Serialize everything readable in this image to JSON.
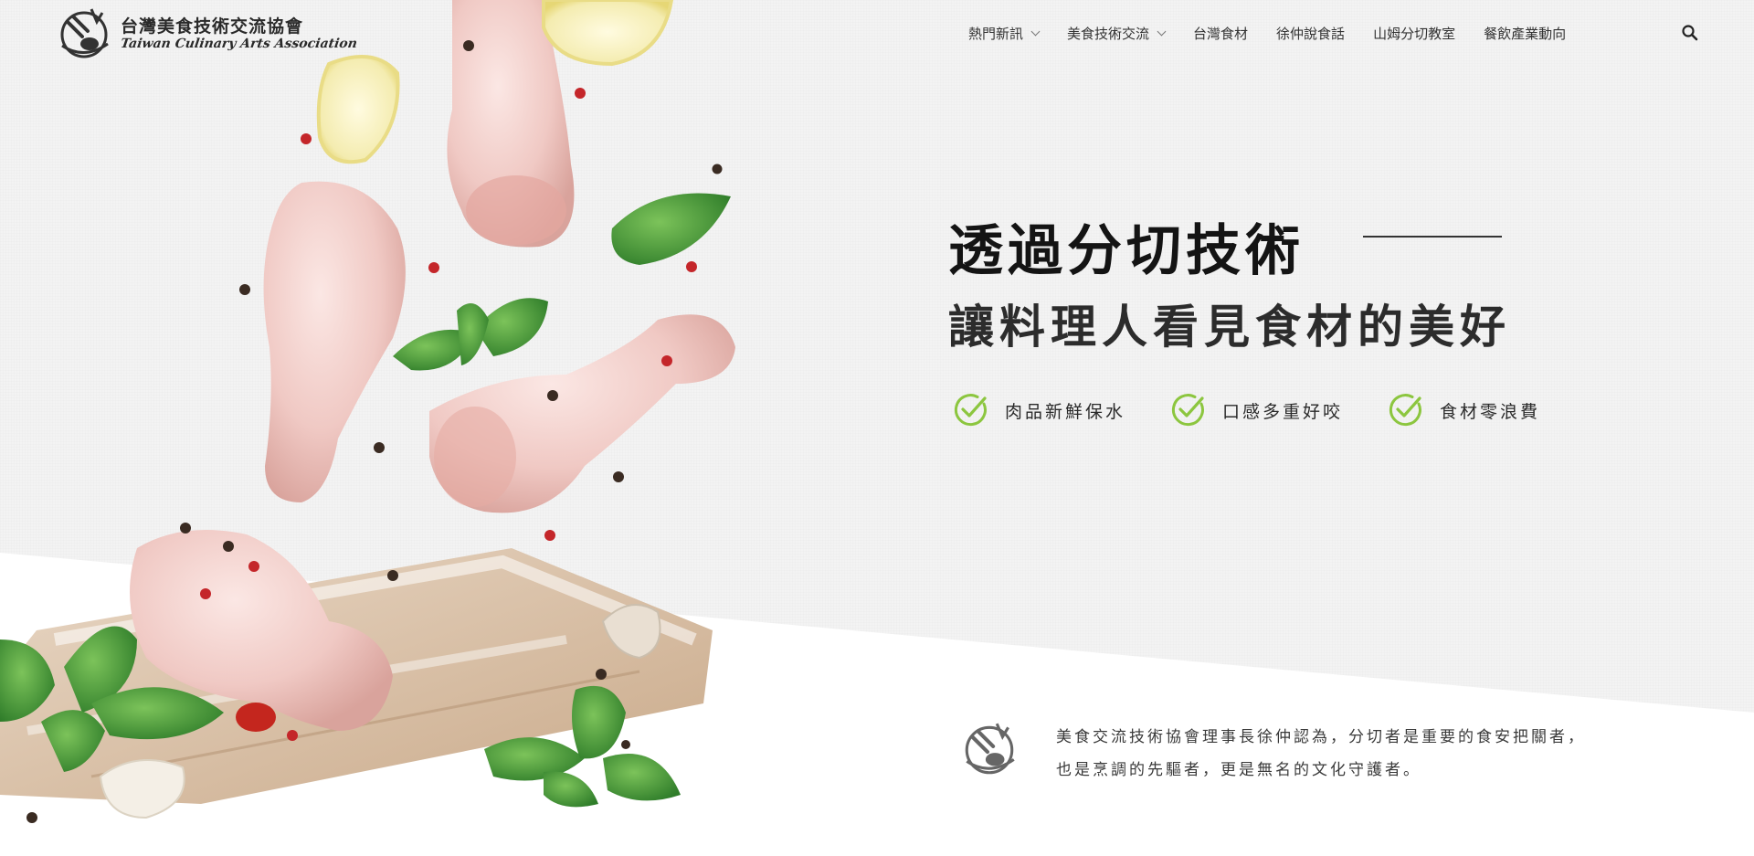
{
  "header": {
    "logo_title": "台灣美食技術交流協會",
    "logo_subtitle": "Taiwan Culinary Arts Association",
    "nav": [
      {
        "label": "熱門新訊",
        "has_dropdown": true
      },
      {
        "label": "美食技術交流",
        "has_dropdown": true
      },
      {
        "label": "台灣食材",
        "has_dropdown": false
      },
      {
        "label": "徐仲說食話",
        "has_dropdown": false
      },
      {
        "label": "山姆分切教室",
        "has_dropdown": false
      },
      {
        "label": "餐飲產業動向",
        "has_dropdown": false
      }
    ],
    "search_icon": "search-icon"
  },
  "hero": {
    "title": "透過分切技術",
    "subtitle": "讓料理人看見食材的美好",
    "features": [
      {
        "label": "肉品新鮮保水",
        "icon": "check-icon"
      },
      {
        "label": "口感多重好咬",
        "icon": "check-icon"
      },
      {
        "label": "食材零浪費",
        "icon": "check-icon"
      }
    ]
  },
  "quote": {
    "line1": "美食交流技術協會理事長徐仲認為，分切者是重要的食安把關者，",
    "line2": "也是烹調的先驅者，更是無名的文化守護者。"
  },
  "colors": {
    "accent_green": "#8cc63f",
    "band_grey": "#f3f3f3",
    "text_dark": "#141414"
  }
}
